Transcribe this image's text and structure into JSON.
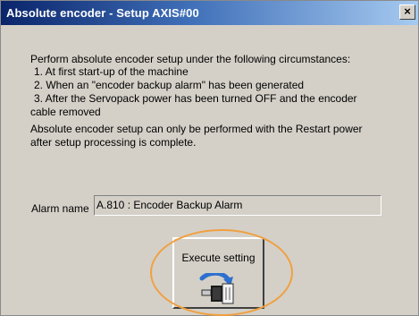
{
  "window": {
    "title": "Absolute encoder - Setup AXIS#00",
    "close_glyph": "×"
  },
  "instructions": {
    "intro": "Perform absolute encoder setup under the following circumstances:",
    "items": [
      "1. At first start-up of the machine",
      "2. When an \"encoder backup alarm\" has been generated",
      "3. After the Servopack power has been turned OFF and the encoder"
    ],
    "item3_cont": "cable removed",
    "note_line1": "Absolute encoder setup can only be performed with the Restart power",
    "note_line2": "after setup processing is complete."
  },
  "alarm": {
    "label": "Alarm name",
    "value": "A.810 : Encoder Backup Alarm"
  },
  "execute": {
    "label": "Execute setting",
    "icon": "encoder-setup-icon"
  },
  "colors": {
    "titlebar_start": "#0a246a",
    "titlebar_end": "#a6caf0",
    "dialog_bg": "#d4d0c8",
    "highlight": "#f0a040",
    "icon_arrow": "#2e6fcf"
  }
}
